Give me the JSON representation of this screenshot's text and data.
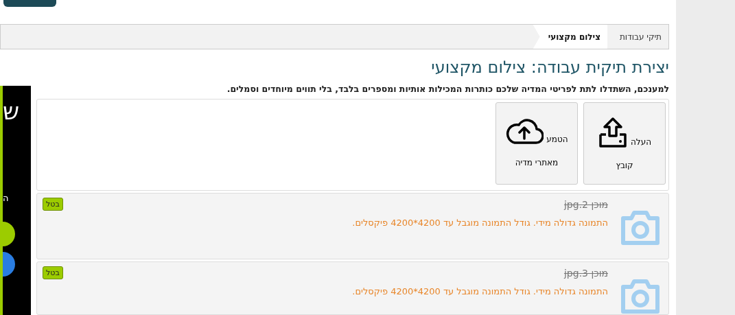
{
  "breadcrumb": [
    {
      "label": "תיקי עבודות",
      "selected": false
    },
    {
      "label": "צילום מקצועי",
      "selected": true
    }
  ],
  "title": "יצירת תיקית עבודה: צילום מקצועי",
  "instruction": "למענכם, השתדלו לתת לפריטי המדיה שלכם כותרות המכילות אותיות ומספרים בלבד, בלי תווים מיוחדים וסמלים.",
  "upload_options": [
    {
      "kind": "file",
      "label": "העלה",
      "sublabel": "קובץ"
    },
    {
      "kind": "cloud",
      "label": "הטמע",
      "sublabel": "מאתרי מדיה"
    }
  ],
  "files": [
    {
      "name": "מוכן 2.jpg",
      "error": "התמונה גדולה מידי. גודל התמונה מוגבל עד 4200*4200 פיקסלים.",
      "cancel": "בטל"
    },
    {
      "name": "מוכן 3.jpg",
      "error": "התמונה גדולה מידי. גודל התמונה מוגבל עד 4200*4200 פיקסלים.",
      "cancel": "בטל"
    }
  ],
  "side_panel": {
    "heading": "ש",
    "text": "ה"
  }
}
